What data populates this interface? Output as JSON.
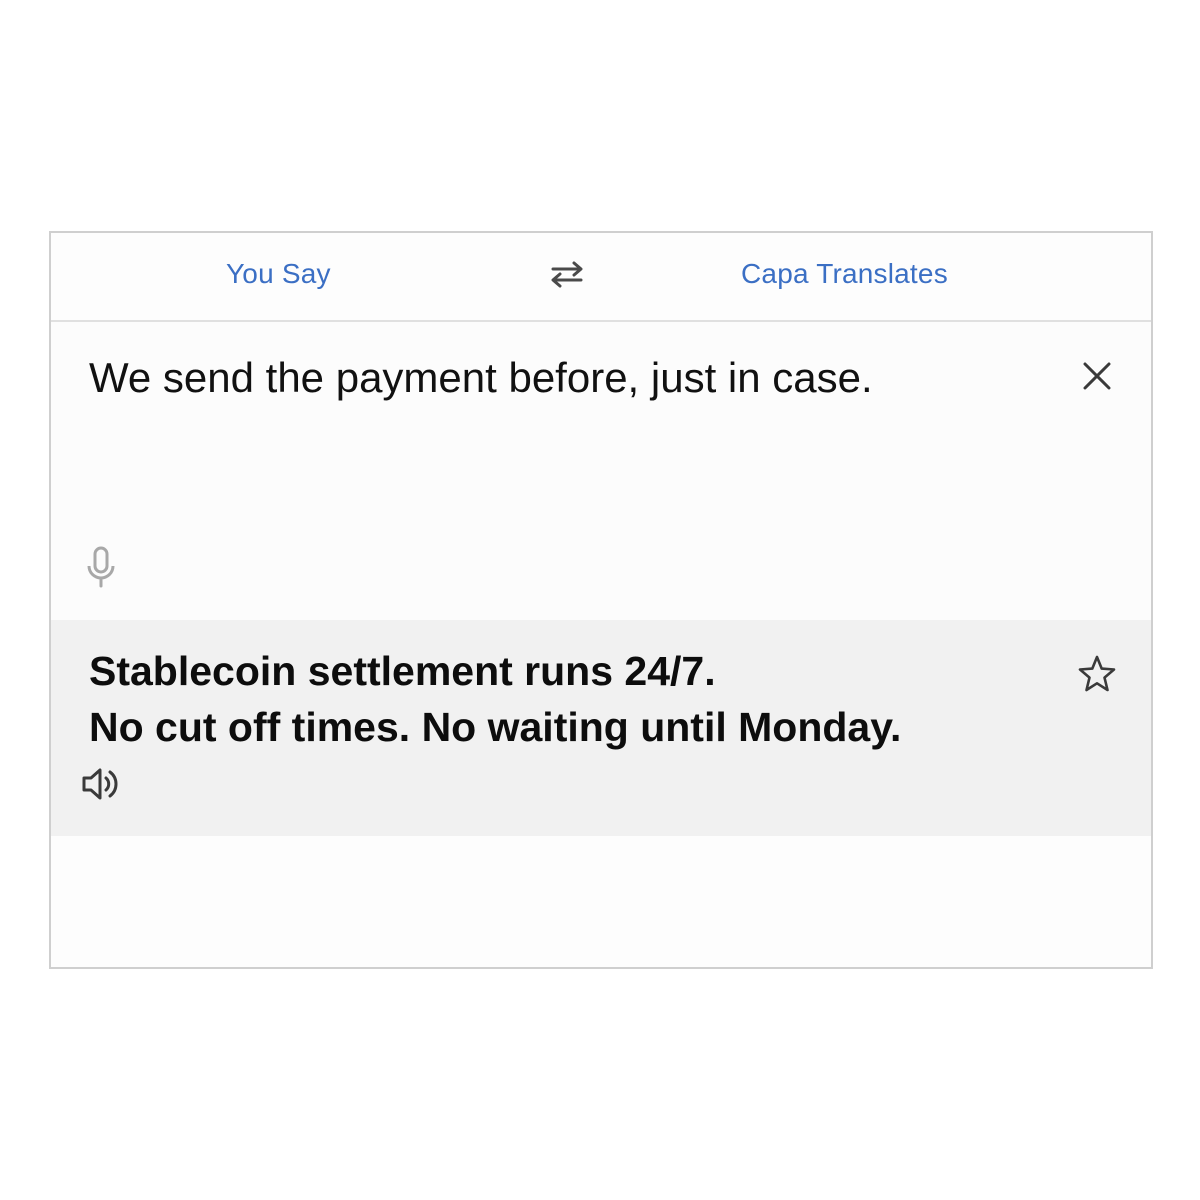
{
  "header": {
    "source_label": "You Say",
    "target_label": "Capa Translates",
    "swap_icon": "swap-arrows-icon"
  },
  "input": {
    "text": "We send the payment before, just in case.",
    "clear_icon": "close-icon",
    "mic_icon": "microphone-icon"
  },
  "output": {
    "line1": "Stablecoin settlement runs 24/7.",
    "line2": "No cut off times. No waiting until Monday.",
    "star_icon": "star-icon",
    "speaker_icon": "speaker-icon"
  },
  "colors": {
    "accent": "#3b6fc4",
    "output_bg": "#f1f1f1",
    "border": "#cfcfcf"
  }
}
